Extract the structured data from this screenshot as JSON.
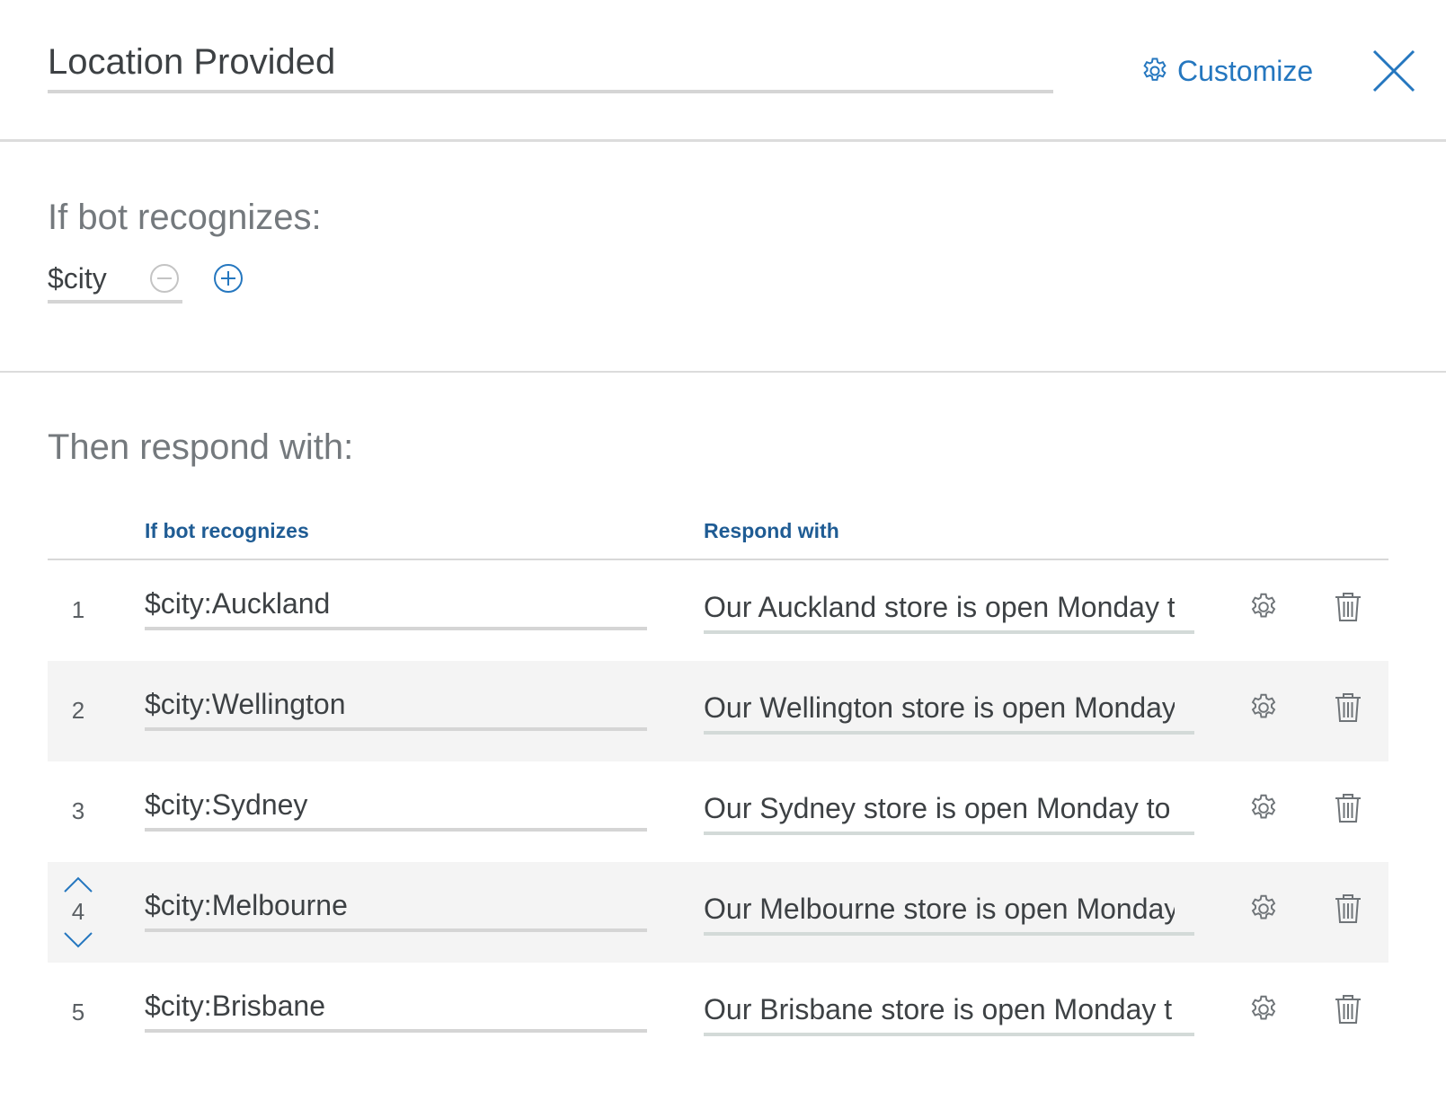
{
  "header": {
    "title_value": "Location Provided",
    "customize_label": "Customize",
    "customize_icon": "gear-icon",
    "close_icon": "close-icon"
  },
  "condition": {
    "heading": "If bot recognizes:",
    "value": "$city",
    "remove_icon": "minus-circle-icon",
    "add_icon": "plus-circle-icon"
  },
  "responses": {
    "heading": "Then respond with:",
    "columns": [
      "If bot recognizes",
      "Respond with"
    ],
    "rows": [
      {
        "number": "1",
        "condition": "$city:Auckland",
        "response": "Our Auckland store is open Monday to"
      },
      {
        "number": "2",
        "condition": "$city:Wellington",
        "response": "Our Wellington store is open Monday"
      },
      {
        "number": "3",
        "condition": "$city:Sydney",
        "response": "Our Sydney store is open Monday to"
      },
      {
        "number": "4",
        "condition": "$city:Melbourne",
        "response": "Our Melbourne store is open Monday"
      },
      {
        "number": "5",
        "condition": "$city:Brisbane",
        "response": "Our Brisbane store is open Monday t"
      }
    ]
  },
  "colors": {
    "accent": "#2577bf",
    "column_header": "#1f5c94",
    "text": "#3d4144",
    "muted_text": "#74797d",
    "row_alt_bg": "#f4f4f4"
  }
}
